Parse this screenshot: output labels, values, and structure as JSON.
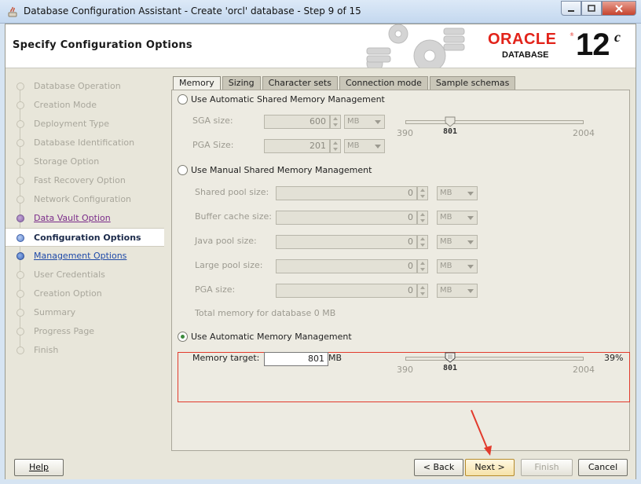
{
  "window": {
    "title": "Database Configuration Assistant - Create 'orcl' database - Step 9 of 15",
    "icons": [
      "java-app-icon",
      "minimize-icon",
      "maximize-icon",
      "close-icon"
    ]
  },
  "header": {
    "page_title": "Specify Configuration Options",
    "brand": "ORACLE",
    "brand_sub": "DATABASE",
    "version": "12",
    "version_suffix": "c"
  },
  "steps": [
    {
      "label": "Database Operation",
      "state": "pending"
    },
    {
      "label": "Creation Mode",
      "state": "pending"
    },
    {
      "label": "Deployment Type",
      "state": "pending"
    },
    {
      "label": "Database Identification",
      "state": "pending"
    },
    {
      "label": "Storage Option",
      "state": "pending"
    },
    {
      "label": "Fast Recovery Option",
      "state": "pending"
    },
    {
      "label": "Network Configuration",
      "state": "pending"
    },
    {
      "label": "Data Vault Option",
      "state": "done"
    },
    {
      "label": "Configuration Options",
      "state": "current"
    },
    {
      "label": "Management Options",
      "state": "next"
    },
    {
      "label": "User Credentials",
      "state": "pending"
    },
    {
      "label": "Creation Option",
      "state": "pending"
    },
    {
      "label": "Summary",
      "state": "pending"
    },
    {
      "label": "Progress Page",
      "state": "pending"
    },
    {
      "label": "Finish",
      "state": "pending"
    }
  ],
  "tabs": [
    "Memory",
    "Sizing",
    "Character sets",
    "Connection mode",
    "Sample schemas"
  ],
  "asmm": {
    "label": "Use Automatic Shared Memory Management",
    "sga_label": "SGA size:",
    "sga_value": "600",
    "pga_label": "PGA Size:",
    "pga_value": "201",
    "unit": "MB",
    "slider_min": "390",
    "slider_value": "801",
    "slider_max": "2004"
  },
  "manual": {
    "label": "Use Manual Shared Memory Management",
    "fields": [
      {
        "label": "Shared pool size:",
        "value": "0",
        "unit": "MB"
      },
      {
        "label": "Buffer cache size:",
        "value": "0",
        "unit": "MB"
      },
      {
        "label": "Java pool size:",
        "value": "0",
        "unit": "MB"
      },
      {
        "label": "Large pool size:",
        "value": "0",
        "unit": "MB"
      },
      {
        "label": "PGA size:",
        "value": "0",
        "unit": "MB"
      }
    ],
    "total": "Total memory for database 0 MB"
  },
  "amm": {
    "label": "Use Automatic Memory Management",
    "selected": true,
    "target_label": "Memory target:",
    "target_value": "801",
    "unit": "MB",
    "slider_min": "390",
    "slider_value": "801",
    "slider_max": "2004",
    "percent": "39%"
  },
  "buttons": {
    "help": "Help",
    "back": "< Back",
    "next": "Next >",
    "finish": "Finish",
    "cancel": "Cancel"
  },
  "colors": {
    "oracle_red": "#e2231a",
    "annotation_red": "#e23a2c"
  }
}
